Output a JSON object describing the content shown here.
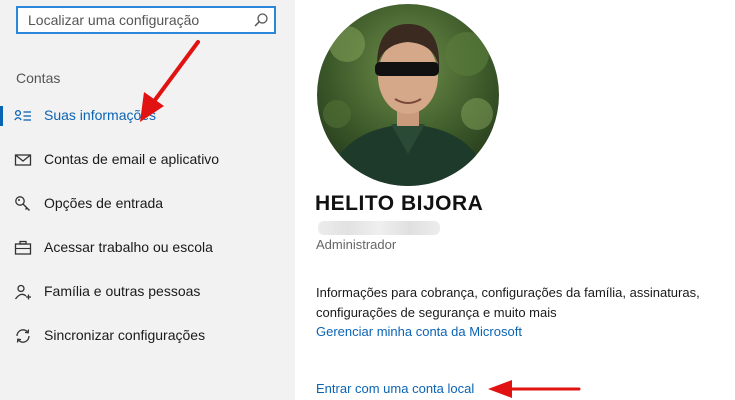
{
  "search": {
    "placeholder": "Localizar uma configuração"
  },
  "sidebar": {
    "section_title": "Contas",
    "items": [
      {
        "label": "Suas informações",
        "icon": "user-info-icon",
        "active": true
      },
      {
        "label": "Contas de email e aplicativo",
        "icon": "mail-icon"
      },
      {
        "label": "Opções de entrada",
        "icon": "key-icon"
      },
      {
        "label": "Acessar trabalho ou escola",
        "icon": "briefcase-icon"
      },
      {
        "label": "Família e outras pessoas",
        "icon": "add-person-icon"
      },
      {
        "label": "Sincronizar configurações",
        "icon": "sync-icon"
      }
    ]
  },
  "profile": {
    "name": "HELITO BIJORA",
    "role": "Administrador",
    "info_text": "Informações para cobrança, configurações da família, assinaturas, configurações de segurança e muito mais",
    "manage_link": "Gerenciar minha conta da Microsoft",
    "local_account_link": "Entrar com uma conta local"
  },
  "colors": {
    "accent": "#0a64b4",
    "focus_border": "#2b88d8",
    "sidebar_bg": "#f2f2f2",
    "annotation_arrow": "#e01212"
  }
}
